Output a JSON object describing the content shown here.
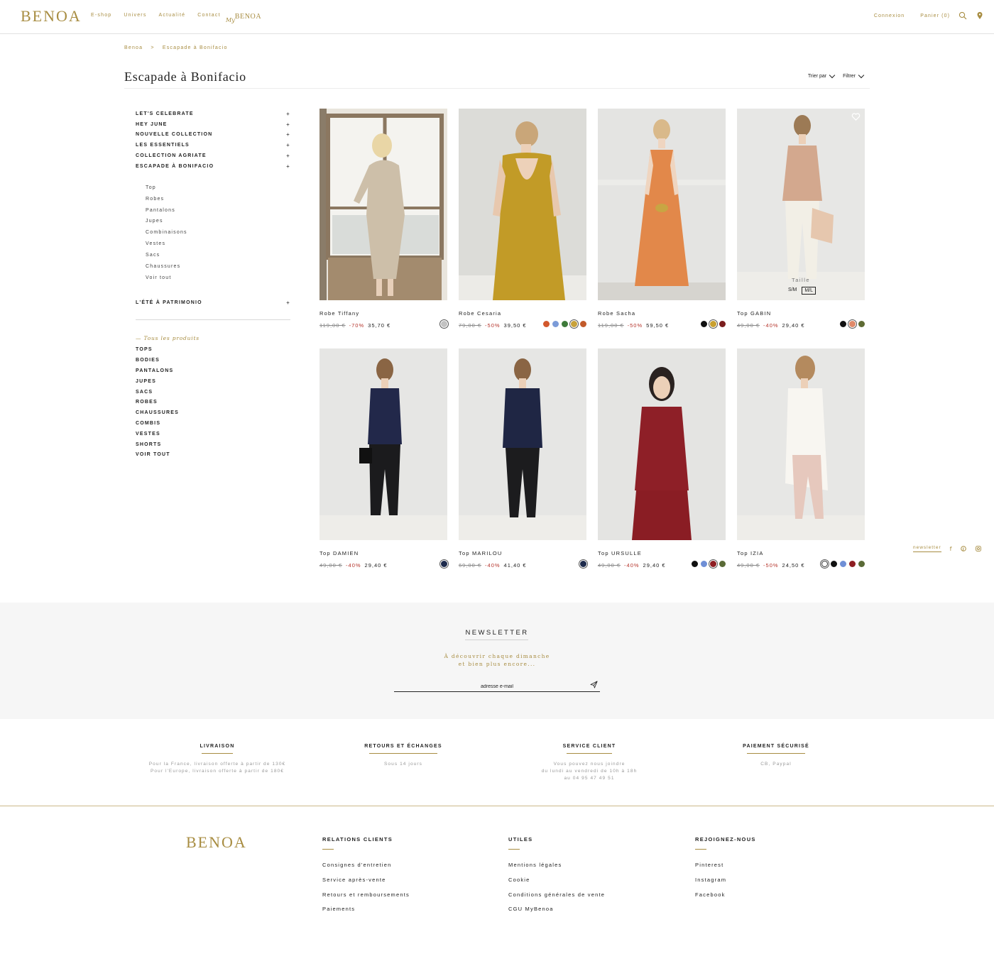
{
  "brand": {
    "name": "BENOA",
    "my_prefix": "My",
    "my_name": "BENOA"
  },
  "nav": [
    "E-shop",
    "Univers",
    "Actualité",
    "Contact"
  ],
  "header_right": {
    "login": "Connexion",
    "cart": "Panier (0)"
  },
  "breadcrumb": {
    "home": "Benoa",
    "sep": ">",
    "current": "Escapade à Bonifacio"
  },
  "page": {
    "title": "Escapade à Bonifacio",
    "sort_label": "Trier par",
    "filter_label": "Filtrer"
  },
  "sidebar": {
    "collections": [
      "LET'S CELEBRATE",
      "HEY JUNE",
      "NOUVELLE COLLECTION",
      "LES ESSENTIELS",
      "COLLECTION AGRIATE",
      "ESCAPADE À BONIFACIO"
    ],
    "subcategories": [
      "Top",
      "Robes",
      "Pantalons",
      "Jupes",
      "Combinaisons",
      "Vestes",
      "Sacs",
      "Chaussures",
      "Voir tout"
    ],
    "extra_collection": "L'ÉTÉ À PATRIMONIO",
    "plus": "+",
    "all_products": "— Tous les produits",
    "types": [
      "TOPS",
      "BODIES",
      "PANTALONS",
      "JUPES",
      "SACS",
      "ROBES",
      "CHAUSSURES",
      "COMBIS",
      "VESTES",
      "SHORTS",
      "VOIR TOUT"
    ]
  },
  "products": [
    {
      "name": "Robe Tiffany",
      "old_price": "119,00 €",
      "discount": "-70%",
      "price": "35,70 €",
      "swatches": [
        "#c2c2c2"
      ],
      "selected": 0
    },
    {
      "name": "Robe Cesaria",
      "old_price": "79,00 €",
      "discount": "-50%",
      "price": "39,50 €",
      "swatches": [
        "#d2582c",
        "#7b9bd8",
        "#3e7a3a",
        "#c8a23b",
        "#c25a2a"
      ],
      "selected": 3
    },
    {
      "name": "Robe Sacha",
      "old_price": "119,00 €",
      "discount": "-50%",
      "price": "59,50 €",
      "swatches": [
        "#111111",
        "#c9a030",
        "#7a1d1d"
      ],
      "selected": 1
    },
    {
      "name": "Top GABIN",
      "old_price": "49,00 €",
      "discount": "-40%",
      "price": "29,40 €",
      "swatches": [
        "#111111",
        "#e08a6a",
        "#5e6b33"
      ],
      "selected": 1,
      "size_label": "Taille",
      "sizes": [
        "S/M",
        "M/L"
      ]
    },
    {
      "name": "Top DAMIEN",
      "old_price": "49,00 €",
      "discount": "-40%",
      "price": "29,40 €",
      "swatches": [
        "#1d2a4c"
      ],
      "selected": 0
    },
    {
      "name": "Top MARILOU",
      "old_price": "69,00 €",
      "discount": "-40%",
      "price": "41,40 €",
      "swatches": [
        "#1d2a4c"
      ],
      "selected": 0
    },
    {
      "name": "Top URSULLE",
      "old_price": "49,00 €",
      "discount": "-40%",
      "price": "29,40 €",
      "swatches": [
        "#111111",
        "#6f8fd6",
        "#8e1e22",
        "#5a6a36"
      ],
      "selected": 2
    },
    {
      "name": "Top IZIA",
      "old_price": "49,00 €",
      "discount": "-50%",
      "price": "24,50 €",
      "swatches": [
        "#ffffff",
        "#111111",
        "#6f8fd6",
        "#8e1e22",
        "#5a6a36"
      ],
      "selected": 0
    }
  ],
  "social": {
    "newsletter": "newsletter",
    "icons": [
      "facebook-icon",
      "pinterest-icon",
      "instagram-icon"
    ]
  },
  "newsletter": {
    "title": "NEWSLETTER",
    "line1": "À découvrir chaque dimanche",
    "line2": "et bien plus encore...",
    "placeholder": "adresse e-mail"
  },
  "services": [
    {
      "title": "LIVRAISON",
      "lines": [
        "Pour la France, livraison offerte à partir de 130€",
        "Pour l'Europe, livraison offerte à partir de 180€"
      ]
    },
    {
      "title": "RETOURS ET ÉCHANGES",
      "lines": [
        "Sous 14 jours"
      ]
    },
    {
      "title": "SERVICE CLIENT",
      "lines": [
        "Vous pouvez nous joindre",
        "du lundi au vendredi de 10h à 18h",
        "au 04 95 47 49 51"
      ]
    },
    {
      "title": "PAIEMENT SÉCURISÉ",
      "lines": [
        "CB, Paypal"
      ]
    }
  ],
  "footer": {
    "columns": [
      {
        "title": "RELATIONS CLIENTS",
        "links": [
          "Consignes d'entretien",
          "Service après-vente",
          "Retours et remboursements",
          "Paiements"
        ]
      },
      {
        "title": "UTILES",
        "links": [
          "Mentions légales",
          "Cookie",
          "Conditions générales de vente",
          "CGU MyBenoa"
        ]
      },
      {
        "title": "REJOIGNEZ-NOUS",
        "links": [
          "Pinterest",
          "Instagram",
          "Facebook"
        ]
      }
    ]
  },
  "colors": {
    "gold": "#a88d42",
    "discount": "#b5342b"
  }
}
